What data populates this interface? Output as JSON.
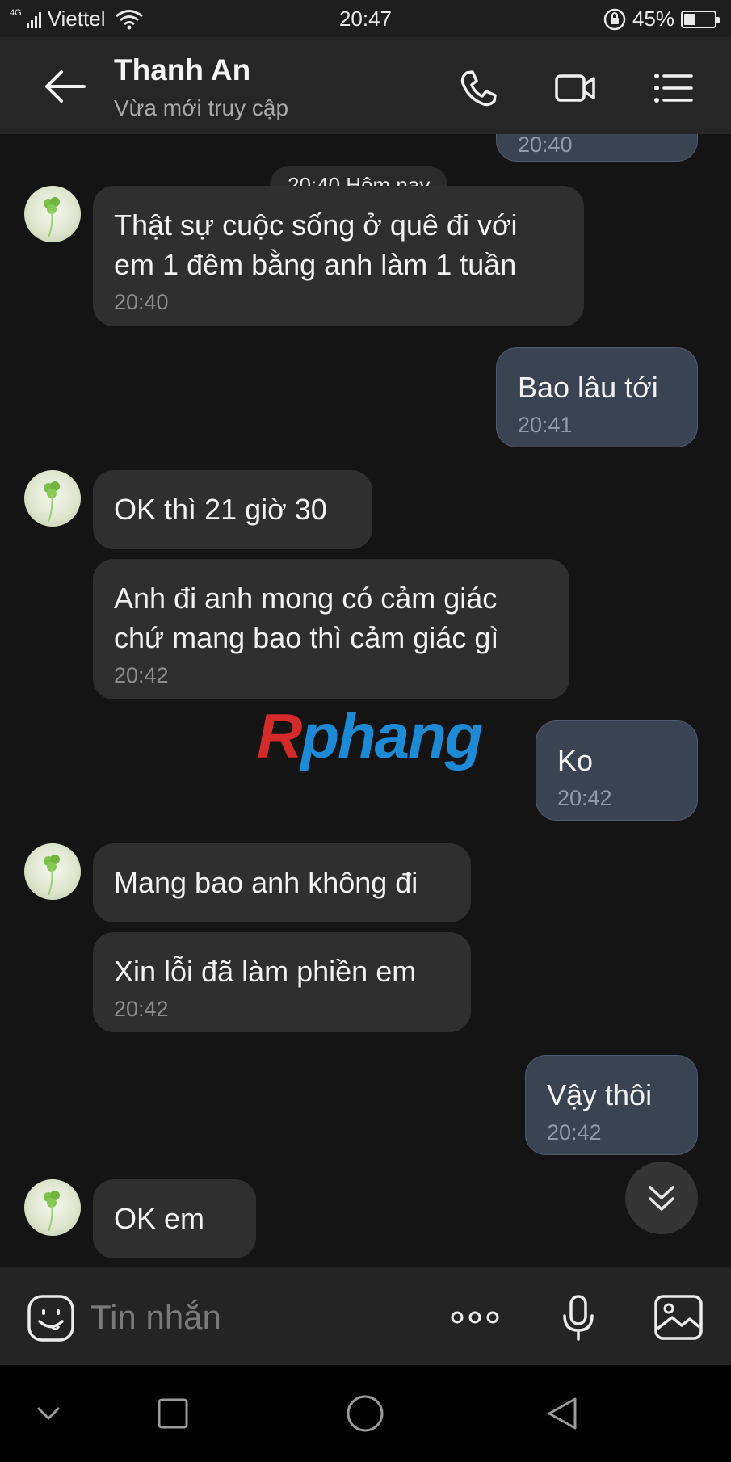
{
  "status_bar": {
    "network_type": "4G",
    "carrier": "Viettel",
    "time": "20:47",
    "battery_percent": "45%",
    "battery_level": 0.45
  },
  "header": {
    "contact_name": "Thanh An",
    "contact_status": "Vừa mới truy cập",
    "icons": [
      "back-arrow-icon",
      "phone-icon",
      "video-camera-icon",
      "menu-list-icon"
    ]
  },
  "conversation": {
    "date_chip": "20:40 Hôm nay",
    "watermark": {
      "first": "R",
      "rest": "phang"
    },
    "messages": [
      {
        "dir": "out",
        "text": "",
        "time": "20:40"
      },
      {
        "dir": "in",
        "lines": [
          "Thật sự cuộc sống ở quê đi với",
          "em 1 đêm bằng anh làm 1 tuần"
        ],
        "time": "20:40"
      },
      {
        "dir": "out",
        "text": "Bao lâu tới",
        "time": "20:41"
      },
      {
        "dir": "in",
        "text": "OK  thì 21 giờ 30",
        "time": ""
      },
      {
        "dir": "in",
        "lines": [
          "Anh đi anh mong có cảm giác",
          "chứ mang bao thì cảm giác gì"
        ],
        "time": "20:42"
      },
      {
        "dir": "out",
        "text": "Ko",
        "time": "20:42"
      },
      {
        "dir": "in",
        "text": "Mang bao anh không đi",
        "time": ""
      },
      {
        "dir": "in",
        "text": "Xin lỗi đã làm phiền em",
        "time": "20:42"
      },
      {
        "dir": "out",
        "text": "Vậy thôi",
        "time": "20:42"
      },
      {
        "dir": "in",
        "text": "OK em",
        "time": ""
      }
    ]
  },
  "input_bar": {
    "placeholder": "Tin nhắn",
    "icons": [
      "emoji-icon",
      "more-dots-icon",
      "microphone-icon",
      "image-gallery-icon"
    ]
  },
  "nav_bar": {
    "icons": [
      "collapse-chevron-icon",
      "recents-square-icon",
      "home-circle-icon",
      "back-triangle-icon"
    ]
  },
  "colors": {
    "background": "#141414",
    "header": "#262626",
    "incoming_bubble": "#2f2f2f",
    "outgoing_bubble": "#3a4352",
    "time_text": "#8d8d8d",
    "watermark_red": "#d42a2a",
    "watermark_blue": "#1c8ad4"
  }
}
